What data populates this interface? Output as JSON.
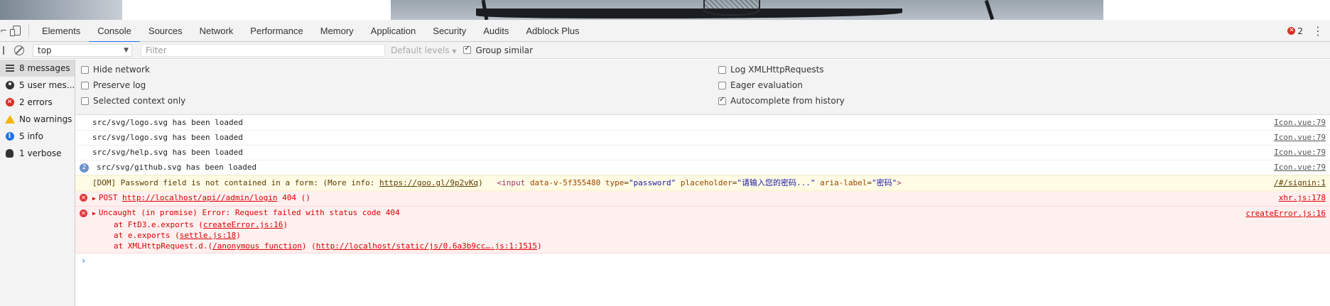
{
  "tabs": [
    "Elements",
    "Console",
    "Sources",
    "Network",
    "Performance",
    "Memory",
    "Application",
    "Security",
    "Audits",
    "Adblock Plus"
  ],
  "active_tab": "Console",
  "error_count": "2",
  "toolbar": {
    "context": "top",
    "filter_placeholder": "Filter",
    "levels": "Default levels",
    "group_similar": "Group similar"
  },
  "settings": {
    "hide_network": "Hide network",
    "preserve_log": "Preserve log",
    "selected_context": "Selected context only",
    "log_xhr": "Log XMLHttpRequests",
    "eager_eval": "Eager evaluation",
    "autocomplete": "Autocomplete from history"
  },
  "sidebar": {
    "items": [
      {
        "label": "8 messages",
        "icon": "list-icon"
      },
      {
        "label": "5 user mes...",
        "icon": "user-icon"
      },
      {
        "label": "2 errors",
        "icon": "error-icon"
      },
      {
        "label": "No warnings",
        "icon": "warning-icon"
      },
      {
        "label": "5 info",
        "icon": "info-icon"
      },
      {
        "label": "1 verbose",
        "icon": "bug-icon"
      }
    ]
  },
  "messages": {
    "m1": {
      "text": "src/svg/logo.svg has been loaded",
      "source": "Icon.vue:79"
    },
    "m2": {
      "text": "src/svg/logo.svg has been loaded",
      "source": "Icon.vue:79"
    },
    "m3": {
      "text": "src/svg/help.svg has been loaded",
      "source": "Icon.vue:79"
    },
    "m4": {
      "count": "2",
      "text": "src/svg/github.svg has been loaded",
      "source": "Icon.vue:79"
    },
    "dom": {
      "prefix": "[DOM] Password field is not contained in a form: (More info: ",
      "link": "https://goo.gl/9p2vKq",
      "suffix": ")",
      "tag_open": "<input",
      "attr1": "data-v-5f355480",
      "attr2": "type",
      "val2": "\"password\"",
      "attr3": "placeholder",
      "val3": "\"请输入您的密码...\"",
      "attr4": "aria-label",
      "val4": "\"密码\"",
      "tag_close": ">",
      "source": "/#/signin:1"
    },
    "post": {
      "method": "POST",
      "url": "http://localhost/api//admin/login",
      "status": "404 ()",
      "source": "xhr.js:178"
    },
    "uncaught": {
      "text": "Uncaught (in promise) Error: Request failed with status code 404",
      "source": "createError.js:16",
      "s1_pre": "at FtD3.e.exports (",
      "s1_link": "createError.js:16",
      "s1_post": ")",
      "s2_pre": "at e.exports (",
      "s2_link": "settle.js:18",
      "s2_post": ")",
      "s3_pre": "at XMLHttpRequest.d.(",
      "s3_link": "/anonymous function",
      "s3_mid": ") (",
      "s3_link2": "http://localhost/static/js/0.6a3b9cc….js:1:1515",
      "s3_post": ")"
    }
  },
  "prompt": "›"
}
